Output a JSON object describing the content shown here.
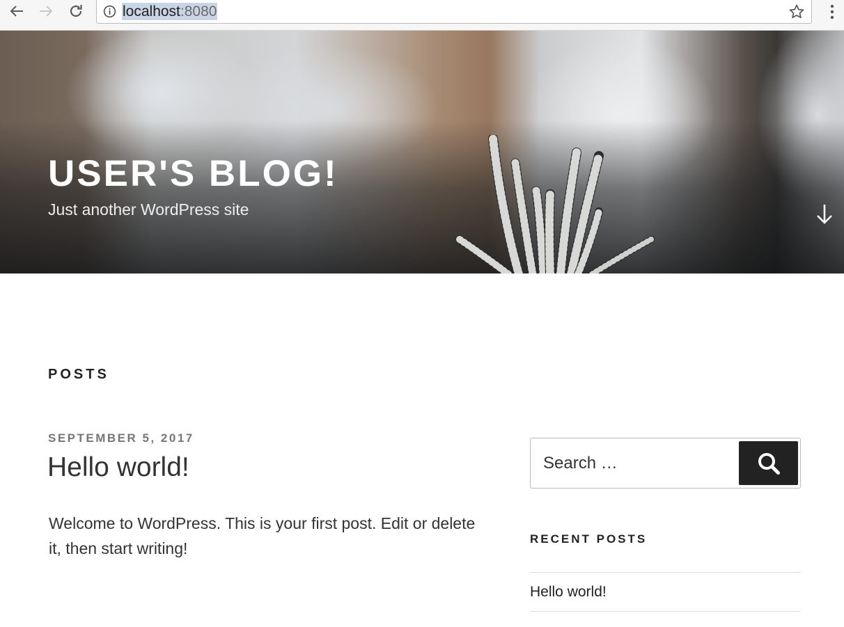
{
  "browser": {
    "url_host": "localhost",
    "url_port": ":8080"
  },
  "site": {
    "title": "USER'S BLOG!",
    "description": "Just another WordPress site"
  },
  "content": {
    "section_heading": "POSTS",
    "post": {
      "date": "SEPTEMBER 5, 2017",
      "title": "Hello world!",
      "excerpt": "Welcome to WordPress. This is your first post. Edit or delete it, then start writing!"
    }
  },
  "sidebar": {
    "search": {
      "placeholder": "Search …",
      "button_icon": "search-icon"
    },
    "recent_posts": {
      "heading": "RECENT POSTS",
      "items": [
        {
          "label": "Hello world!"
        }
      ]
    }
  },
  "icons": {
    "back": "back-arrow-icon",
    "forward": "forward-arrow-icon",
    "reload": "reload-icon",
    "info": "info-icon",
    "star": "star-icon",
    "menu": "kebab-menu-icon",
    "scroll": "arrow-down-icon"
  },
  "colors": {
    "accent_dark": "#222222",
    "muted_text": "#767676",
    "url_highlight": "#c9d4e4"
  }
}
